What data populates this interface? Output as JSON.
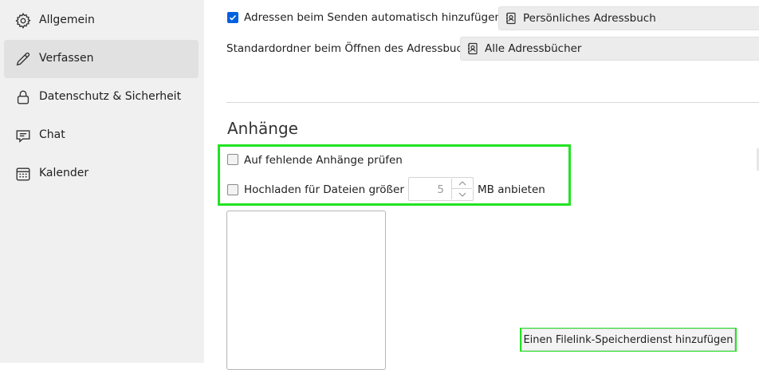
{
  "sidebar": {
    "items": [
      {
        "label": "Allgemein",
        "icon": "gear-icon",
        "active": false
      },
      {
        "label": "Verfassen",
        "icon": "pencil-icon",
        "active": true
      },
      {
        "label": "Datenschutz & Sicherheit",
        "icon": "lock-icon",
        "active": false
      },
      {
        "label": "Chat",
        "icon": "chat-icon",
        "active": false
      },
      {
        "label": "Kalender",
        "icon": "calendar-icon",
        "active": false
      }
    ]
  },
  "addressing": {
    "auto_add_label": "Adressen beim Senden automatisch hinzufügen zu:",
    "auto_add_checked": true,
    "auto_add_select": "Persönliches Adressbuch",
    "default_folder_label": "Standardordner beim Öffnen des Adressbuchs:",
    "default_folder_select": "Alle Adressbücher"
  },
  "attachments": {
    "title": "Anhänge",
    "check_missing_label": "Auf fehlende Anhänge prüfen",
    "check_missing_checked": false,
    "upload_label": "Hochladen für Dateien größer als",
    "upload_checked": false,
    "upload_size": "5",
    "upload_suffix": "MB anbieten",
    "add_filelink_button": "Einen Filelink-Speicherdienst hinzufügen"
  },
  "colors": {
    "accent": "#0060df",
    "highlight": "#22e322",
    "sidebar_bg": "#f0f0f0",
    "sidebar_active_bg": "#e1e1e1"
  }
}
